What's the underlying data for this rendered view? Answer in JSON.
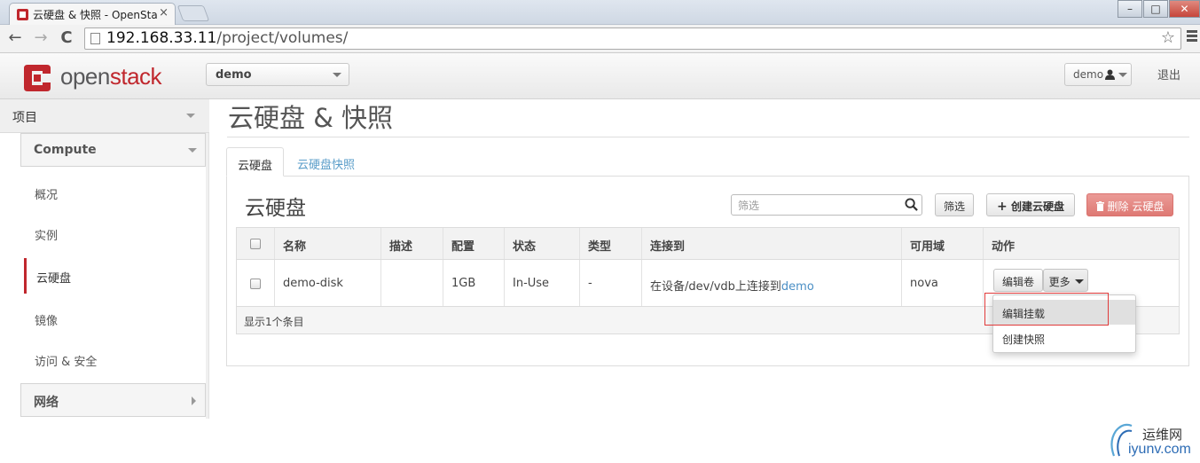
{
  "browser": {
    "tab_title": "云硬盘 & 快照 - OpenSta",
    "tab_close": "×",
    "url_host": "192.168.33.11",
    "url_path": "/project/volumes/",
    "back": "←",
    "forward": "→",
    "reload": "C",
    "star": "☆",
    "win_min": "–",
    "win_max": "□",
    "win_close": "✕"
  },
  "header": {
    "logo_pre": "open",
    "logo_post": "stack",
    "project_select": "demo",
    "user_button": "demo",
    "logout": "退出"
  },
  "sidebar": {
    "project": "项目",
    "compute": "Compute",
    "items": [
      "概况",
      "实例",
      "云硬盘",
      "镜像",
      "访问 & 安全"
    ],
    "network": "网络"
  },
  "page": {
    "title": "云硬盘 & 快照",
    "tabs": [
      "云硬盘",
      "云硬盘快照"
    ],
    "table_title": "云硬盘",
    "filter_placeholder": "筛选",
    "filter_button": "筛选",
    "create_button": "创建云硬盘",
    "delete_button": "删除 云硬盘"
  },
  "table": {
    "columns": [
      "名称",
      "描述",
      "配置",
      "状态",
      "类型",
      "连接到",
      "可用域",
      "动作"
    ],
    "rows": [
      {
        "name": "demo-disk",
        "description": "",
        "size": "1GB",
        "status": "In-Use",
        "type": "-",
        "attached_prefix": "在设备/dev/vdb上连接到",
        "attached_link": "demo",
        "zone": "nova",
        "edit_button": "编辑卷",
        "more_button": "更多"
      }
    ],
    "footer": "显示1个条目"
  },
  "dropdown": {
    "items": [
      "编辑挂载",
      "创建快照"
    ]
  },
  "watermark": {
    "line1": "运维网",
    "line2": "iyunv.com"
  },
  "colors": {
    "brand": "#c0272d",
    "link": "#4b8fc5",
    "danger": "#d9625c"
  }
}
